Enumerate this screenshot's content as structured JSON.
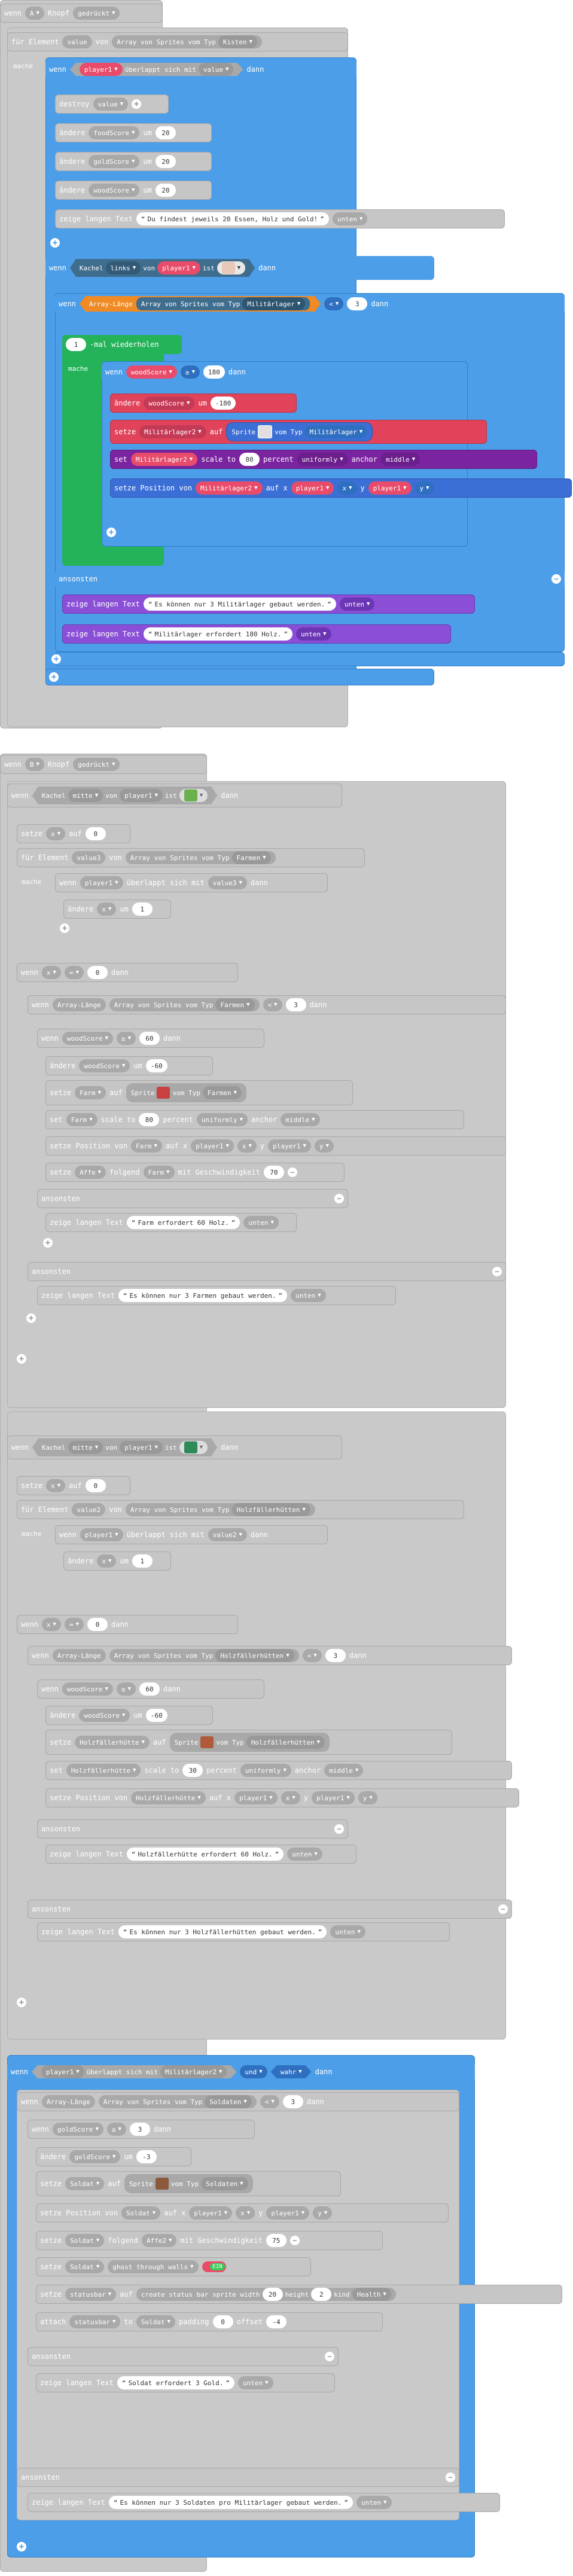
{
  "e1": {
    "header": {
      "wenn": "wenn",
      "key": "A",
      "kopf": "Knopf",
      "state": "gedrückt"
    },
    "forEach": {
      "fuer": "für Element",
      "var": "value",
      "von": "von",
      "array": "Array von Sprites vom Typ",
      "type": "Kisten"
    },
    "mache": "mache",
    "if1": {
      "wenn": "wenn",
      "a": "player1",
      "mid": "überlappt sich mit",
      "b": "value",
      "dann": "dann"
    },
    "destroy": {
      "label": "destroy",
      "var": "value"
    },
    "change": [
      {
        "label": "ändere",
        "var": "foodScore",
        "um": "um",
        "val": "20"
      },
      {
        "label": "ändere",
        "var": "goldScore",
        "um": "um",
        "val": "20"
      },
      {
        "label": "ändere",
        "var": "woodScore",
        "um": "um",
        "val": "20"
      }
    ],
    "say": {
      "label": "zeige langen Text",
      "text": "Du findest jeweils 20 Essen, Holz und Gold!",
      "pos": "unten"
    },
    "if2": {
      "wenn": "wenn",
      "tile": "Kachel",
      "dir": "links",
      "von": "von",
      "sprite": "player1",
      "ist": "ist",
      "dann": "dann"
    },
    "if3": {
      "wenn": "wenn",
      "len": "Array-Länge",
      "arr": "Array von Sprites vom Typ",
      "type": "Militärlager",
      "op": "<",
      "val": "3",
      "dann": "dann"
    },
    "repeat": {
      "n": "1",
      "label": "-mal wiederholen",
      "mache": "mache"
    },
    "if4": {
      "wenn": "wenn",
      "var": "woodScore",
      "op": "≥",
      "val": "180",
      "dann": "dann"
    },
    "change2": {
      "label": "ändere",
      "var": "woodScore",
      "um": "um",
      "val": "-180"
    },
    "setSprite": {
      "label": "setze",
      "var": "Militärlager2",
      "auf": "auf",
      "sprite": "Sprite",
      "vom": "vom Typ",
      "type": "Militärlager"
    },
    "scale": {
      "set": "set",
      "var": "Militärlager2",
      "scale": "scale to",
      "val": "80",
      "pct": "percent",
      "mode": "uniformly",
      "anchor": "anchor",
      "pos": "middle"
    },
    "pos": {
      "label": "setze Position von",
      "var": "Militärlager2",
      "aufx": "auf x",
      "p1": "player1",
      "x": "x",
      "y": "y",
      "p2": "player1",
      "yy": "y"
    },
    "else": "ansonsten",
    "say2": {
      "label": "zeige langen Text",
      "text": "Es können nur 3 Militärlager gebaut werden.",
      "pos": "unten"
    },
    "say3": {
      "label": "zeige langen Text",
      "text": "Militärlager erfordert 180 Holz.",
      "pos": "unten"
    }
  },
  "e2": {
    "header": {
      "wenn": "wenn",
      "key": "B",
      "kopf": "Knopf",
      "state": "gedrückt"
    },
    "ifA": {
      "wenn": "wenn",
      "tile": "Kachel",
      "dir": "mitte",
      "von": "von",
      "sprite": "player1",
      "ist": "ist",
      "dann": "dann"
    },
    "setA": {
      "label": "setze",
      "var": "x",
      "auf": "auf",
      "val": "0"
    },
    "forA": {
      "fuer": "für Element",
      "var": "value3",
      "von": "von",
      "array": "Array von Sprites vom Typ",
      "type": "Farmen"
    },
    "ifA2": {
      "wenn": "wenn",
      "a": "player1",
      "mid": "überlappt sich mit",
      "b": "value3",
      "dann": "dann"
    },
    "chgA": {
      "label": "ändere",
      "var": "x",
      "um": "um",
      "val": "1"
    },
    "ifA3": {
      "wenn": "wenn",
      "var": "x",
      "op": "=",
      "val": "0",
      "dann": "dann"
    },
    "ifA4": {
      "wenn": "wenn",
      "len": "Array-Länge",
      "arr": "Array von Sprites vom Typ",
      "type": "Farmen",
      "op": "<",
      "val": "3",
      "dann": "dann"
    },
    "ifA5": {
      "wenn": "wenn",
      "var": "woodScore",
      "op": "≥",
      "val": "60",
      "dann": "dann"
    },
    "chgA2": {
      "label": "ändere",
      "var": "woodScore",
      "um": "um",
      "val": "-60"
    },
    "setFarm": {
      "label": "setze",
      "var": "Farm",
      "auf": "auf",
      "sprite": "Sprite",
      "vom": "vom Typ",
      "type": "Farmen"
    },
    "scaleFarm": {
      "set": "set",
      "var": "Farm",
      "scale": "scale to",
      "val": "80",
      "pct": "percent",
      "mode": "uniformly",
      "anchor": "anchor",
      "pos": "middle"
    },
    "posFarm": {
      "label": "setze Position von",
      "var": "Farm",
      "aufx": "auf x",
      "p1": "player1",
      "x": "x",
      "y": "y",
      "p2": "player1",
      "yy": "y"
    },
    "follow": {
      "label": "setze",
      "var": "Affe",
      "mid": "folgend",
      "target": "Farm",
      "speed": "mit Geschwindigkeit",
      "val": "70"
    },
    "else": "ansonsten",
    "sayA1": {
      "label": "zeige langen Text",
      "text": "Farm erfordert 60 Holz.",
      "pos": "unten"
    },
    "sayA2": {
      "label": "zeige langen Text",
      "text": "Es können nur 3 Farmen gebaut werden.",
      "pos": "unten"
    },
    "ifB": {
      "wenn": "wenn",
      "tile": "Kachel",
      "dir": "mitte",
      "von": "von",
      "sprite": "player1",
      "ist": "ist",
      "dann": "dann"
    },
    "setB": {
      "label": "setze",
      "var": "x",
      "auf": "auf",
      "val": "0"
    },
    "forB": {
      "fuer": "für Element",
      "var": "value2",
      "von": "von",
      "array": "Array von Sprites vom Typ",
      "type": "Holzfällerhütten"
    },
    "ifB2": {
      "wenn": "wenn",
      "a": "player1",
      "mid": "überlappt sich mit",
      "b": "value2",
      "dann": "dann"
    },
    "chgB": {
      "label": "ändere",
      "var": "x",
      "um": "um",
      "val": "1"
    },
    "ifB3": {
      "wenn": "wenn",
      "var": "x",
      "op": "=",
      "val": "0",
      "dann": "dann"
    },
    "ifB4": {
      "wenn": "wenn",
      "len": "Array-Länge",
      "arr": "Array von Sprites vom Typ",
      "type": "Holzfällerhütten",
      "op": "<",
      "val": "3",
      "dann": "dann"
    },
    "ifB5": {
      "wenn": "wenn",
      "var": "woodScore",
      "op": "≥",
      "val": "60",
      "dann": "dann"
    },
    "chgB2": {
      "label": "ändere",
      "var": "woodScore",
      "um": "um",
      "val": "-60"
    },
    "setHut": {
      "label": "setze",
      "var": "Holzfällerhütte",
      "auf": "auf",
      "sprite": "Sprite",
      "vom": "vom Typ",
      "type": "Holzfällerhütten"
    },
    "scaleHut": {
      "set": "set",
      "var": "Holzfällerhütte",
      "scale": "scale to",
      "val": "30",
      "pct": "percent",
      "mode": "uniformly",
      "anchor": "anchor",
      "pos": "middle"
    },
    "posHut": {
      "label": "setze Position von",
      "var": "Holzfällerhütte",
      "aufx": "auf x",
      "p1": "player1",
      "x": "x",
      "y": "y",
      "p2": "player1",
      "yy": "y"
    },
    "sayB1": {
      "label": "zeige langen Text",
      "text": "Holzfällerhütte erfordert 60 Holz.",
      "pos": "unten"
    },
    "sayB2": {
      "label": "zeige langen Text",
      "text": "Es können nur 3 Holzfällerhütten gebaut werden.",
      "pos": "unten"
    },
    "ifC": {
      "wenn": "wenn",
      "a": "player1",
      "mid": "überlappt sich mit",
      "b": "Militärlager2",
      "und": "und",
      "bool": "wahr",
      "dann": "dann"
    },
    "ifC2": {
      "wenn": "wenn",
      "len": "Array-Länge",
      "arr": "Array von Sprites vom Typ",
      "type": "Soldaten",
      "op": "<",
      "val": "3",
      "dann": "dann"
    },
    "ifC3": {
      "wenn": "wenn",
      "var": "goldScore",
      "op": "≥",
      "val": "3",
      "dann": "dann"
    },
    "chgC": {
      "label": "ändere",
      "var": "goldScore",
      "um": "um",
      "val": "-3"
    },
    "setSoldat": {
      "label": "setze",
      "var": "Soldat",
      "auf": "auf",
      "sprite": "Sprite",
      "vom": "vom Typ",
      "type": "Soldaten"
    },
    "posSoldat": {
      "label": "setze Position von",
      "var": "Soldat",
      "aufx": "auf x",
      "p1": "player1",
      "x": "x",
      "y": "y",
      "p2": "player1",
      "yy": "y"
    },
    "followS": {
      "label": "setze",
      "var": "Soldat",
      "mid": "folgend",
      "target": "Affe2",
      "speed": "mit Geschwindigkeit",
      "val": "75"
    },
    "ghost": {
      "label": "setze",
      "var": "Soldat",
      "flag": "ghost through walls",
      "state": "EIN"
    },
    "status": {
      "label": "setze",
      "var": "statusbar",
      "auf": "auf",
      "create": "create status bar sprite width",
      "w": "20",
      "h": "height",
      "hv": "2",
      "kind": "kind",
      "k": "Health"
    },
    "attach": {
      "label": "attach",
      "var": "statusbar",
      "to": "to",
      "target": "Soldat",
      "pad": "padding",
      "pv": "0",
      "off": "offset",
      "ov": "-4"
    },
    "sayC1": {
      "label": "zeige langen Text",
      "text": "Soldat erfordert 3 Gold.",
      "pos": "unten"
    },
    "sayC2": {
      "label": "zeige langen Text",
      "text": "Es können nur 3 Soldaten pro Militärlager gebaut werden.",
      "pos": "unten"
    }
  }
}
